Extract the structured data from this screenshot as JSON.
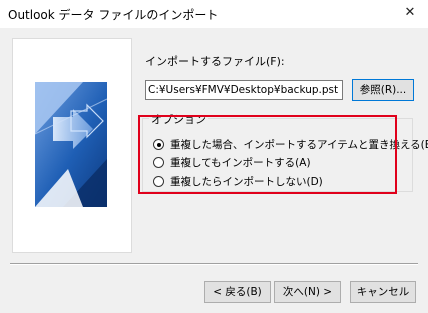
{
  "window": {
    "title": "Outlook データ ファイルのインポート",
    "close_glyph": "✕"
  },
  "file": {
    "label": "インポートするファイル(F):",
    "path": "C:¥Users¥FMV¥Desktop¥backup.pst",
    "browse_label": "参照(R)..."
  },
  "options": {
    "legend": "オプション",
    "items": [
      {
        "label": "重複した場合、インポートするアイテムと置き換える(E)",
        "selected": true
      },
      {
        "label": "重複してもインポートする(A)",
        "selected": false
      },
      {
        "label": "重複したらインポートしない(D)",
        "selected": false
      }
    ]
  },
  "buttons": {
    "back": "< 戻る(B)",
    "next": "次へ(N) >",
    "cancel": "キャンセル"
  },
  "colors": {
    "highlight": "#e0001b",
    "focus_border": "#0078d7",
    "graphic_blue": "#1b4f9c"
  },
  "icons": {
    "close": "close-icon",
    "wizard_graphic": "import-wizard-graphic"
  }
}
